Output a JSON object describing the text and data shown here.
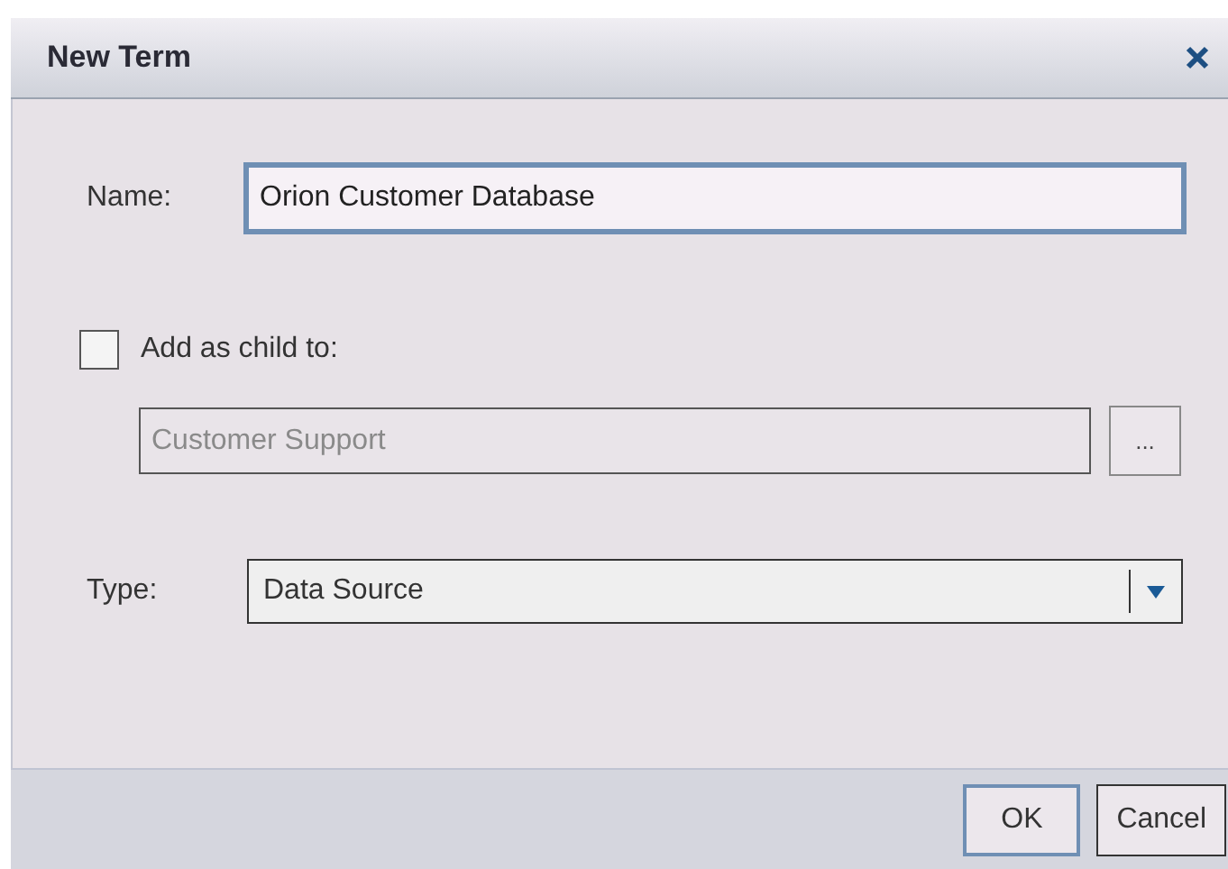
{
  "window": {
    "title": "New Term"
  },
  "name_field": {
    "label": "Name:",
    "value": "Orion Customer Database",
    "focused": true
  },
  "add_as_child": {
    "label": "Add as child to:",
    "checked": false
  },
  "parent_field": {
    "value": "Customer Support",
    "disabled": true,
    "browse_label": "..."
  },
  "type_field": {
    "label": "Type:",
    "value": "Data Source"
  },
  "buttons": [
    {
      "label": "OK",
      "default": true
    },
    {
      "label": "Cancel",
      "default": false
    }
  ]
}
